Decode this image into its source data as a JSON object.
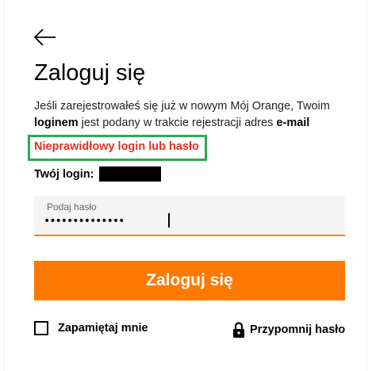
{
  "header": {
    "back_icon": "arrow-left-icon"
  },
  "form": {
    "title": "Zaloguj się",
    "info_part1": "Jeśli zarejestrowałeś się już w nowym Mój Orange, Twoim",
    "info_bold1": "loginem",
    "info_part2": " jest podany w trakcie rejestracji adres ",
    "info_bold2": "e-mail",
    "error_message": "Nieprawidłowy login lub hasło",
    "login_label": "Twój login:",
    "password_label": "Podaj hasło",
    "password_value": "••••••••••••••",
    "submit_label": "Zaloguj się",
    "remember_label": "Zapamiętaj mnie",
    "remember_checked": false,
    "forgot_label": "Przypomnij hasło",
    "forgot_icon": "lock-icon"
  },
  "colors": {
    "accent": "#ff7900",
    "error": "#e0311f",
    "highlight_border": "#2eaa4f",
    "field_background": "#f4f4f4"
  }
}
